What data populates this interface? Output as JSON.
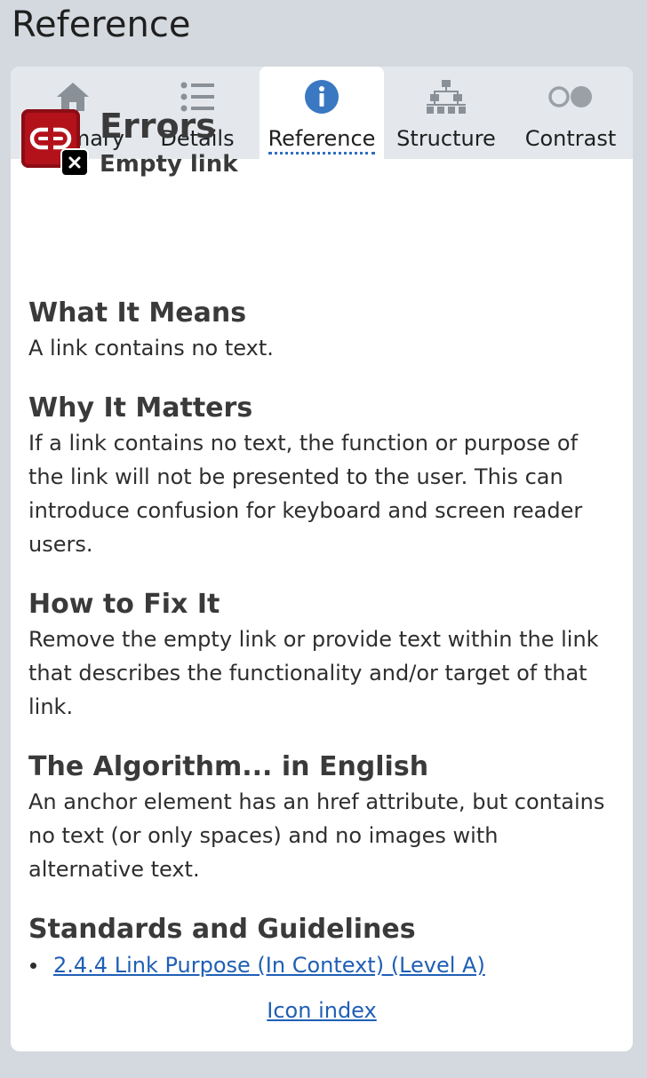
{
  "panel": {
    "title": "Reference"
  },
  "tabs": [
    {
      "label": "Summary",
      "icon": "home-icon"
    },
    {
      "label": "Details",
      "icon": "list-icon"
    },
    {
      "label": "Reference",
      "icon": "info-icon",
      "active": true
    },
    {
      "label": "Structure",
      "icon": "hierarchy-icon"
    },
    {
      "label": "Contrast",
      "icon": "contrast-icon"
    }
  ],
  "error": {
    "category": "Errors",
    "name": "Empty link",
    "icon": "broken-link-icon"
  },
  "sections": {
    "meaning": {
      "heading": "What It Means",
      "text": "A link contains no text."
    },
    "why": {
      "heading": "Why It Matters",
      "text": "If a link contains no text, the function or purpose of the link will not be presented to the user. This can introduce confusion for keyboard and screen reader users."
    },
    "fix": {
      "heading": "How to Fix It",
      "text": "Remove the empty link or provide text within the link that describes the functionality and/or target of that link."
    },
    "algorithm": {
      "heading": "The Algorithm... in English",
      "text": "An anchor element has an href attribute, but contains no text (or only spaces) and no images with alternative text."
    },
    "standards": {
      "heading": "Standards and Guidelines",
      "items": [
        "2.4.4 Link Purpose (In Context) (Level A)"
      ]
    }
  },
  "footer": {
    "icon_index_label": "Icon index"
  },
  "colors": {
    "accent": "#1f5fb5",
    "error_red": "#b3121b",
    "info_blue": "#3a78c2"
  }
}
